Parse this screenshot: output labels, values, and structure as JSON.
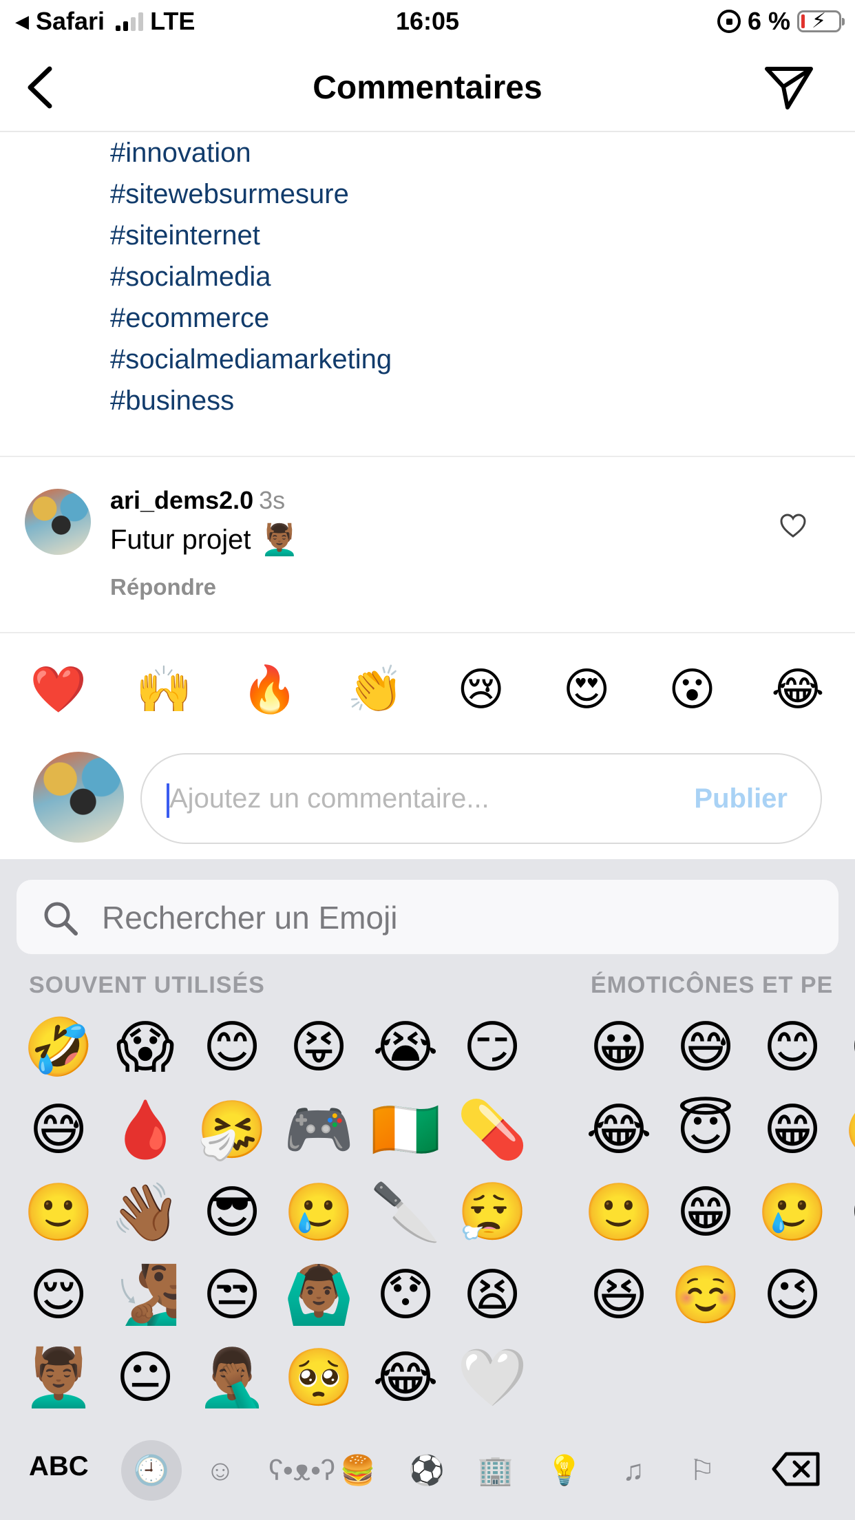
{
  "status_bar": {
    "back_app": "Safari",
    "network": "LTE",
    "time": "16:05",
    "battery_percent": "6 %"
  },
  "nav": {
    "title": "Commentaires"
  },
  "caption": {
    "hashtags": [
      "#innovation",
      "#sitewebsurmesure",
      "#siteinternet",
      "#socialmedia",
      "#ecommerce",
      "#socialmediamarketing",
      "#business"
    ]
  },
  "comment": {
    "username": "ari_dems2.0",
    "time": "3s",
    "text": "Futur projet",
    "emoji": "💆🏾‍♂️",
    "reply_label": "Répondre"
  },
  "quick_reactions": [
    "❤️",
    "🙌",
    "🔥",
    "👏",
    "😢",
    "😍",
    "😮",
    "😂"
  ],
  "composer": {
    "placeholder": "Ajoutez un commentaire...",
    "publish_label": "Publier"
  },
  "keyboard": {
    "search_placeholder": "Rechercher un Emoji",
    "frequent_heading": "SOUVENT UTILISÉS",
    "smileys_heading": "ÉMOTICÔNES ET PE",
    "frequent": [
      "🤣",
      "😱",
      "😊",
      "😝",
      "😭",
      "😏",
      "😅",
      "🩸",
      "🤧",
      "🎮",
      "🇨🇮",
      "💊",
      "🙂",
      "👋🏾",
      "😎",
      "🥲",
      "🔪",
      "😮‍💨",
      "😌",
      "🧏🏾‍♂️",
      "😒",
      "🙆🏾‍♂️",
      "😯",
      "😫",
      "💆🏾‍♂️",
      "😐",
      "🤦🏾‍♂️",
      "🥺",
      "😂",
      "🤍"
    ],
    "smileys": [
      "😀",
      "😅",
      "😊",
      "😃",
      "😂",
      "😇",
      "😁",
      "🤣",
      "🙂",
      "😁",
      "🥲",
      "🙃",
      "😆",
      "☺️",
      "😉"
    ],
    "abc_label": "ABC",
    "category_icons": [
      "clock-icon",
      "smiley-icon",
      "bear-icon",
      "food-icon",
      "ball-icon",
      "building-icon",
      "bulb-icon",
      "symbols-icon",
      "flag-icon"
    ]
  }
}
